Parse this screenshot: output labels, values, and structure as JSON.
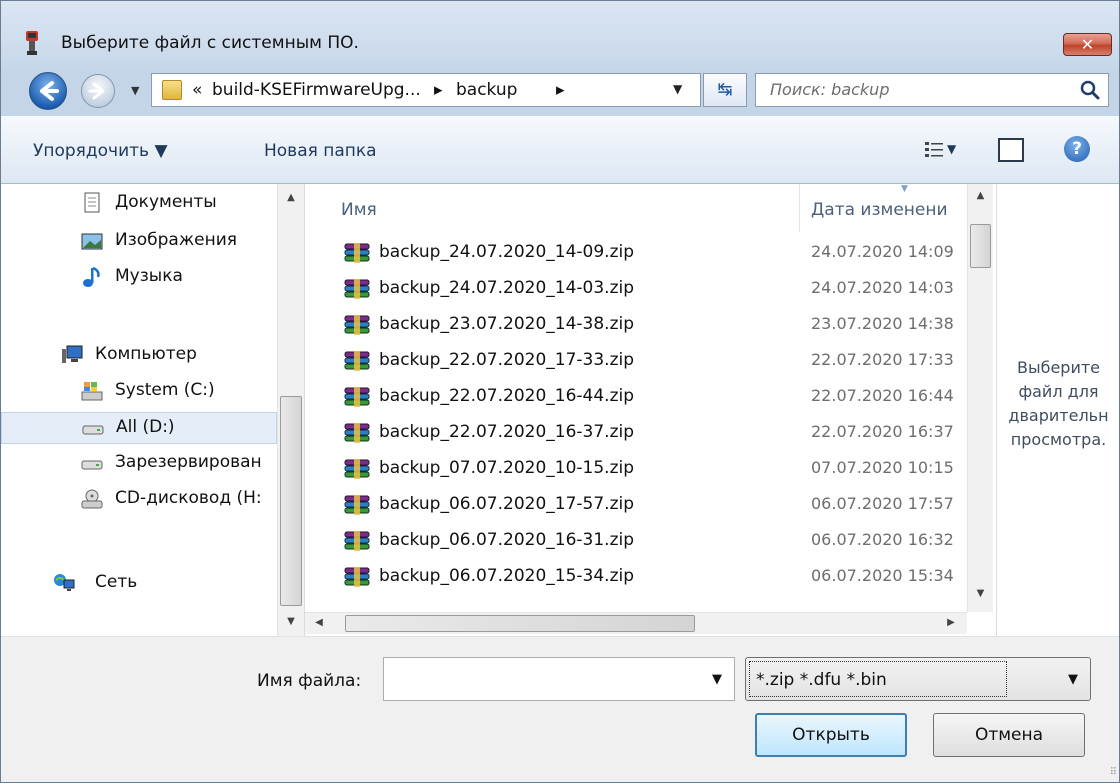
{
  "window": {
    "title": "Выберите файл с системным ПО.",
    "close_label": "✕"
  },
  "navigation": {
    "breadcrumb_prefix": "«",
    "breadcrumb": [
      "build-KSEFirmwareUpg...",
      "backup"
    ],
    "separator": "▸",
    "search_placeholder": "Поиск: backup"
  },
  "toolbar": {
    "organize_label": "Упорядочить ▼",
    "new_folder_label": "Новая папка"
  },
  "sidebar": {
    "items": [
      {
        "label": "Документы",
        "icon": "documents-icon",
        "selected": false
      },
      {
        "label": "Изображения",
        "icon": "pictures-icon",
        "selected": false
      },
      {
        "label": "Музыка",
        "icon": "music-icon",
        "selected": false
      },
      {
        "label": "Компьютер",
        "icon": "computer-icon",
        "selected": false
      },
      {
        "label": "System (C:)",
        "icon": "system-drive-icon",
        "selected": false
      },
      {
        "label": "All (D:)",
        "icon": "drive-icon",
        "selected": true
      },
      {
        "label": "Зарезервирован",
        "icon": "drive-icon",
        "selected": false
      },
      {
        "label": "CD-дисковод (H:",
        "icon": "cd-drive-icon",
        "selected": false
      },
      {
        "label": "Сеть",
        "icon": "network-icon",
        "selected": false
      }
    ]
  },
  "file_list": {
    "columns": [
      "Имя",
      "Дата изменени"
    ],
    "rows": [
      {
        "name": "backup_24.07.2020_14-09.zip",
        "date": "24.07.2020 14:09"
      },
      {
        "name": "backup_24.07.2020_14-03.zip",
        "date": "24.07.2020 14:03"
      },
      {
        "name": "backup_23.07.2020_14-38.zip",
        "date": "23.07.2020 14:38"
      },
      {
        "name": "backup_22.07.2020_17-33.zip",
        "date": "22.07.2020 17:33"
      },
      {
        "name": "backup_22.07.2020_16-44.zip",
        "date": "22.07.2020 16:44"
      },
      {
        "name": "backup_22.07.2020_16-37.zip",
        "date": "22.07.2020 16:37"
      },
      {
        "name": "backup_07.07.2020_10-15.zip",
        "date": "07.07.2020 10:15"
      },
      {
        "name": "backup_06.07.2020_17-57.zip",
        "date": "06.07.2020 17:57"
      },
      {
        "name": "backup_06.07.2020_16-31.zip",
        "date": "06.07.2020 16:32"
      },
      {
        "name": "backup_06.07.2020_15-34.zip",
        "date": "06.07.2020 15:34"
      }
    ]
  },
  "preview": {
    "lines": [
      "Выберите",
      "файл для",
      "дварительн",
      "просмотра."
    ]
  },
  "footer": {
    "filename_label": "Имя файла:",
    "filename_value": "",
    "filter_value": "*.zip *.dfu *.bin",
    "open_label": "Открыть",
    "cancel_label": "Отмена"
  },
  "colors": {
    "frame": "#c5d5e8",
    "accent": "#3c7fb1",
    "close_red": "#c0432b"
  }
}
